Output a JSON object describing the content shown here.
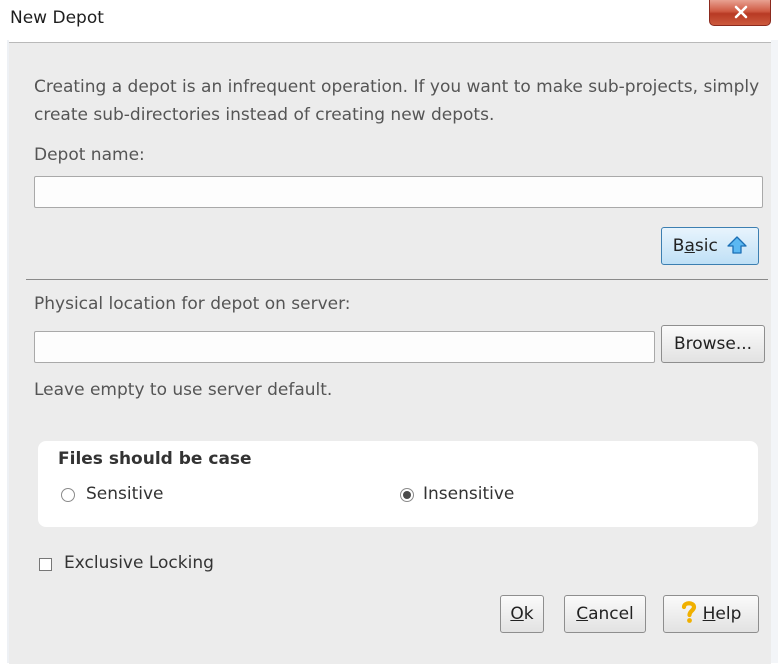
{
  "window": {
    "title": "New Depot",
    "close_glyph": "X"
  },
  "intro_text": "Creating a depot is an infrequent operation. If you want to make sub-projects, simply create sub-directories instead of creating new depots.",
  "depot_name": {
    "label": "Depot name:",
    "value": ""
  },
  "basic_button": {
    "prefix": "B",
    "mnemonic": "a",
    "suffix": "sic",
    "icon": "up-arrow-icon"
  },
  "location": {
    "label": "Physical location for depot on server:",
    "value": "",
    "browse_label": "Browse...",
    "hint": "Leave empty to use server default."
  },
  "case": {
    "title": "Files should be case",
    "options": [
      {
        "label": "Sensitive",
        "selected": false
      },
      {
        "label": "Insensitive",
        "selected": true
      }
    ]
  },
  "exclusive_locking": {
    "label": "Exclusive Locking",
    "checked": false
  },
  "buttons": {
    "ok": {
      "mnemonic": "O",
      "rest": "k"
    },
    "cancel": {
      "mnemonic": "C",
      "rest": "ancel"
    },
    "help": {
      "mnemonic": "H",
      "rest": "elp",
      "icon": "question-mark-icon"
    }
  },
  "colors": {
    "close_red": "#c9503a",
    "basic_blue": "#bfe0f6",
    "help_yellow": "#f5b800"
  }
}
